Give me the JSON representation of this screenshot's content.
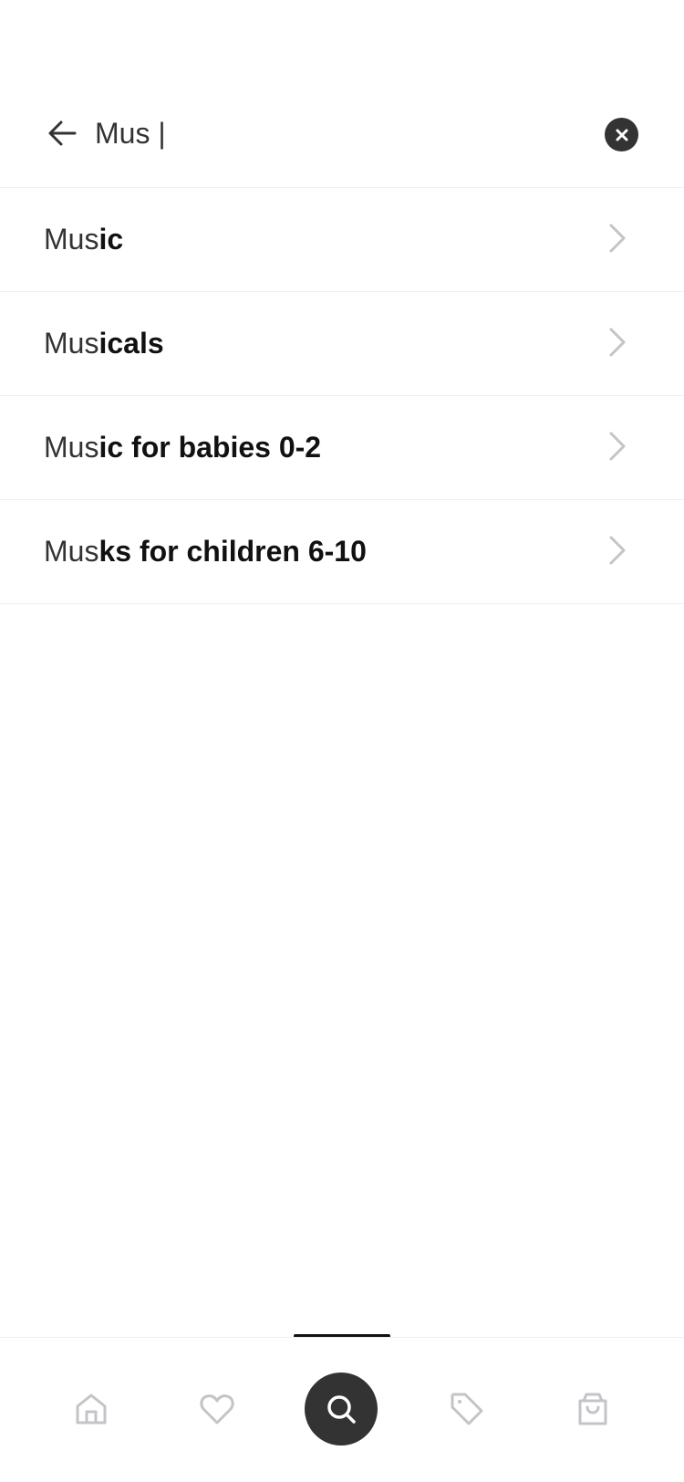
{
  "search": {
    "value": "Mus |",
    "placeholder": ""
  },
  "suggestions": [
    {
      "match": "Mus",
      "rest": "ic"
    },
    {
      "match": "Mus",
      "rest": "icals"
    },
    {
      "match": "Mus",
      "rest": "ic for babies 0-2"
    },
    {
      "match": "Mus",
      "rest": "ks for children 6-10"
    }
  ],
  "nav": {
    "items": [
      "home-icon",
      "heart-icon",
      "search-icon",
      "tag-icon",
      "shopping-bag-icon"
    ],
    "active": "search-icon"
  },
  "colors": {
    "dark": "#333333",
    "icon_muted": "#c4c4c8",
    "divider": "#efefef"
  }
}
